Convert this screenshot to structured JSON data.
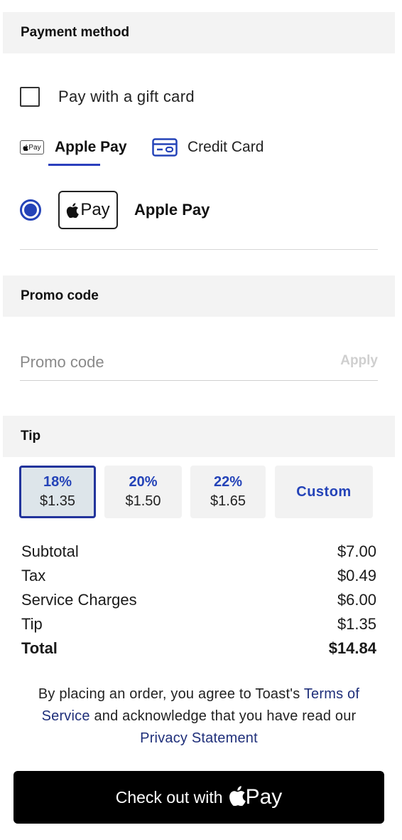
{
  "payment": {
    "header": "Payment method",
    "gift_card_label": "Pay with a gift card",
    "tabs": [
      {
        "label": "Apple Pay",
        "icon": "apple-pay-icon",
        "active": true
      },
      {
        "label": "Credit Card",
        "icon": "credit-card-icon",
        "active": false
      }
    ],
    "mini_badge": "Pay",
    "badge_text": "Pay",
    "selected_method_label": "Apple Pay"
  },
  "promo": {
    "header": "Promo code",
    "placeholder": "Promo code",
    "apply_label": "Apply"
  },
  "tip": {
    "header": "Tip",
    "options": [
      {
        "percent": "18%",
        "amount": "$1.35",
        "selected": true
      },
      {
        "percent": "20%",
        "amount": "$1.50",
        "selected": false
      },
      {
        "percent": "22%",
        "amount": "$1.65",
        "selected": false
      }
    ],
    "custom_label": "Custom"
  },
  "summary": {
    "rows": [
      {
        "label": "Subtotal",
        "value": "$7.00"
      },
      {
        "label": "Tax",
        "value": "$0.49"
      },
      {
        "label": "Service Charges",
        "value": "$6.00"
      },
      {
        "label": "Tip",
        "value": "$1.35"
      }
    ],
    "total": {
      "label": "Total",
      "value": "$14.84"
    }
  },
  "legal": {
    "prefix": "By placing an order, you agree to Toast's",
    "terms_link": "Terms of Service",
    "middle": "and acknowledge that you have read our",
    "privacy_link": "Privacy Statement"
  },
  "checkout": {
    "label": "Check out with",
    "pay_text": "Pay"
  },
  "colors": {
    "accent": "#2443b8",
    "selected_tip_bg": "#dde5ea",
    "section_bg": "#f3f3f3",
    "checkout_bg": "#000000"
  }
}
